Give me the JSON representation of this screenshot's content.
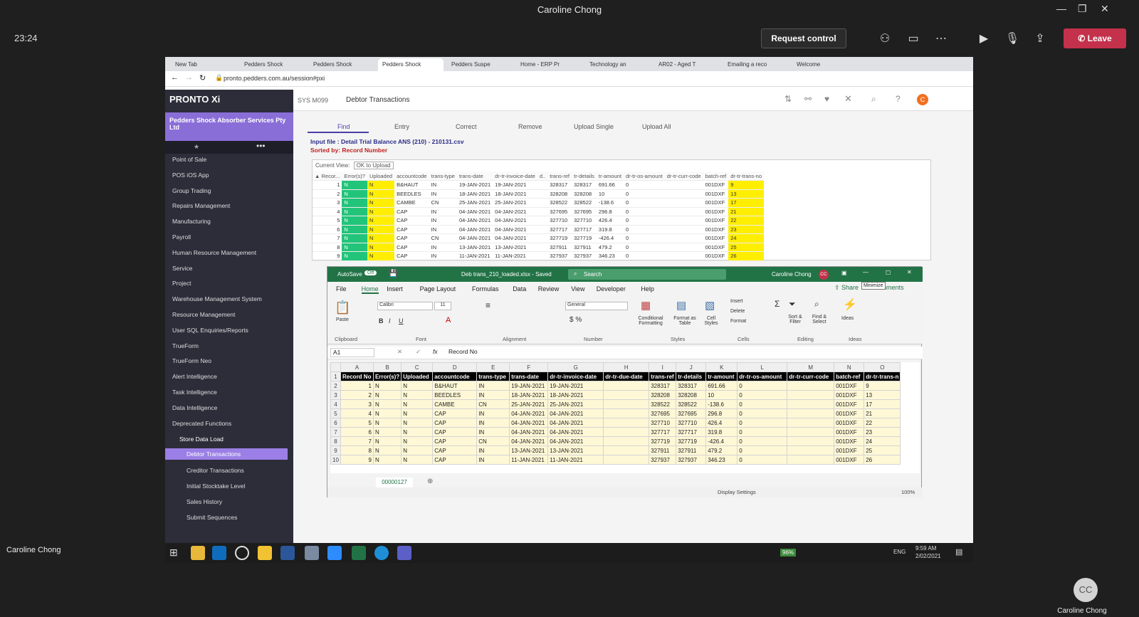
{
  "teams": {
    "title": "Caroline Chong",
    "timer": "23:24",
    "request_control": "Request control",
    "leave": "Leave",
    "participant": "Caroline Chong",
    "avatar_initials": "CC",
    "participant_tile": "Caroline Chong"
  },
  "browser": {
    "tabs": [
      "New Tab",
      "Pedders Shock",
      "Pedders Shock",
      "Pedders Shock",
      "Pedders Suspe",
      "Home - ERP Pr",
      "Technology an",
      "AR02 - Aged T",
      "Emailing a reco",
      "Welcome"
    ],
    "url": "pronto.pedders.com.au/session#pxi"
  },
  "pronto": {
    "logo": "PRONTO Xi",
    "company": "Pedders Shock Absorber Services Pty Ltd",
    "sys": "SYS M099",
    "screen_title": "Debtor Transactions",
    "nav": [
      "Point of Sale",
      "POS iOS App",
      "Group Trading",
      "Repairs Management",
      "Manufacturing",
      "Payroll",
      "Human Resource Management",
      "Service",
      "Project",
      "Warehouse Management System",
      "Resource Management",
      "User SQL Enquiries/Reports",
      "TrueForm",
      "TrueForm Neo",
      "Alert Intelligence",
      "Task Intelligence",
      "Data Intelligence",
      "Deprecated Functions"
    ],
    "store_data_load": "Store Data Load",
    "subnav": [
      "Debtor Transactions",
      "Creditor Transactions",
      "Initial Stocktake Level",
      "Sales History",
      "Submit Sequences"
    ],
    "actions": [
      "Find",
      "Entry",
      "Correct",
      "Remove",
      "Upload Single",
      "Upload All"
    ],
    "input_file": "Input file : Detail Trial Balance ANS (210) - 210131.csv",
    "sorted_by": "Sorted by: Record Number",
    "current_view_label": "Current View:",
    "current_view": "OK to Upload",
    "columns": [
      "▲ Recor...",
      "Error(s)?",
      "Uploaded",
      "accountcode",
      "trans-type",
      "trans-date",
      "dr-tr-invoice-date",
      "d..",
      "trans-ref",
      "tr-details",
      "tr-amount",
      "dr-tr-os-amount",
      "dr-tr-curr-code",
      "batch-ref",
      "dr-tr-trans-no"
    ],
    "rows": [
      [
        "1",
        "N",
        "N",
        "B&HAUT",
        "IN",
        "19-JAN-2021",
        "19-JAN-2021",
        "",
        "328317",
        "328317",
        "691.66",
        "0",
        "",
        "001DXF",
        "9"
      ],
      [
        "2",
        "N",
        "N",
        "BEEDLES",
        "IN",
        "18-JAN-2021",
        "18-JAN-2021",
        "",
        "328208",
        "328208",
        "10",
        "0",
        "",
        "001DXF",
        "13"
      ],
      [
        "3",
        "N",
        "N",
        "CAMBE",
        "CN",
        "25-JAN-2021",
        "25-JAN-2021",
        "",
        "328522",
        "328522",
        "-138.6",
        "0",
        "",
        "001DXF",
        "17"
      ],
      [
        "4",
        "N",
        "N",
        "CAP",
        "IN",
        "04-JAN-2021",
        "04-JAN-2021",
        "",
        "327695",
        "327695",
        "296.8",
        "0",
        "",
        "001DXF",
        "21"
      ],
      [
        "5",
        "N",
        "N",
        "CAP",
        "IN",
        "04-JAN-2021",
        "04-JAN-2021",
        "",
        "327710",
        "327710",
        "426.4",
        "0",
        "",
        "001DXF",
        "22"
      ],
      [
        "6",
        "N",
        "N",
        "CAP",
        "IN",
        "04-JAN-2021",
        "04-JAN-2021",
        "",
        "327717",
        "327717",
        "319.8",
        "0",
        "",
        "001DXF",
        "23"
      ],
      [
        "7",
        "N",
        "N",
        "CAP",
        "CN",
        "04-JAN-2021",
        "04-JAN-2021",
        "",
        "327719",
        "327719",
        "-426.4",
        "0",
        "",
        "001DXF",
        "24"
      ],
      [
        "8",
        "N",
        "N",
        "CAP",
        "IN",
        "13-JAN-2021",
        "13-JAN-2021",
        "",
        "327911",
        "327911",
        "479.2",
        "0",
        "",
        "001DXF",
        "25"
      ],
      [
        "9",
        "N",
        "N",
        "CAP",
        "IN",
        "11-JAN-2021",
        "11-JAN-2021",
        "",
        "327937",
        "327937",
        "346.23",
        "0",
        "",
        "001DXF",
        "26"
      ]
    ]
  },
  "excel": {
    "autosave": "AutoSave",
    "autosave_state": "Off",
    "filename": "Deb trans_210_loaded.xlsx - Saved",
    "search": "Search",
    "user": "Caroline Chong",
    "user_initials": "CC",
    "tooltip": "Minimize",
    "menu": [
      "File",
      "Home",
      "Insert",
      "Page Layout",
      "Formulas",
      "Data",
      "Review",
      "View",
      "Developer",
      "Help"
    ],
    "share": "Share",
    "comments": "Comments",
    "font": "Calibri",
    "font_size": "11",
    "number_format": "General",
    "groups": [
      "Clipboard",
      "Font",
      "Alignment",
      "Number",
      "Styles",
      "Cells",
      "Editing",
      "Ideas"
    ],
    "ribbon_buttons": [
      "Paste",
      "Conditional Formatting",
      "Format as Table",
      "Cell Styles",
      "Insert",
      "Delete",
      "Format",
      "Sort & Filter",
      "Find & Select",
      "Ideas"
    ],
    "namebox": "A1",
    "formula": "Record No",
    "col_letters": [
      "A",
      "B",
      "C",
      "D",
      "E",
      "F",
      "G",
      "H",
      "I",
      "J",
      "K",
      "L",
      "M",
      "N",
      "O"
    ],
    "header": [
      "Record No",
      "Error(s)?",
      "Uploaded",
      "accountcode",
      "trans-type",
      "trans-date",
      "dr-tr-invoice-date",
      "dr-tr-due-date",
      "trans-ref",
      "tr-details",
      "tr-amount",
      "dr-tr-os-amount",
      "dr-tr-curr-code",
      "batch-ref",
      "dr-tr-trans-n"
    ],
    "rows": [
      [
        "2",
        "1",
        "N",
        "N",
        "B&HAUT",
        "IN",
        "19-JAN-2021",
        "19-JAN-2021",
        "",
        "328317",
        "328317",
        "691.66",
        "0",
        "",
        "001DXF",
        "9"
      ],
      [
        "3",
        "2",
        "N",
        "N",
        "BEEDLES",
        "IN",
        "18-JAN-2021",
        "18-JAN-2021",
        "",
        "328208",
        "328208",
        "10",
        "0",
        "",
        "001DXF",
        "13"
      ],
      [
        "4",
        "3",
        "N",
        "N",
        "CAMBE",
        "CN",
        "25-JAN-2021",
        "25-JAN-2021",
        "",
        "328522",
        "328522",
        "-138.6",
        "0",
        "",
        "001DXF",
        "17"
      ],
      [
        "5",
        "4",
        "N",
        "N",
        "CAP",
        "IN",
        "04-JAN-2021",
        "04-JAN-2021",
        "",
        "327695",
        "327695",
        "296.8",
        "0",
        "",
        "001DXF",
        "21"
      ],
      [
        "6",
        "5",
        "N",
        "N",
        "CAP",
        "IN",
        "04-JAN-2021",
        "04-JAN-2021",
        "",
        "327710",
        "327710",
        "426.4",
        "0",
        "",
        "001DXF",
        "22"
      ],
      [
        "7",
        "6",
        "N",
        "N",
        "CAP",
        "IN",
        "04-JAN-2021",
        "04-JAN-2021",
        "",
        "327717",
        "327717",
        "319.8",
        "0",
        "",
        "001DXF",
        "23"
      ],
      [
        "8",
        "7",
        "N",
        "N",
        "CAP",
        "CN",
        "04-JAN-2021",
        "04-JAN-2021",
        "",
        "327719",
        "327719",
        "-426.4",
        "0",
        "",
        "001DXF",
        "24"
      ],
      [
        "9",
        "8",
        "N",
        "N",
        "CAP",
        "IN",
        "13-JAN-2021",
        "13-JAN-2021",
        "",
        "327911",
        "327911",
        "479.2",
        "0",
        "",
        "001DXF",
        "25"
      ],
      [
        "10",
        "9",
        "N",
        "N",
        "CAP",
        "IN",
        "11-JAN-2021",
        "11-JAN-2021",
        "",
        "327937",
        "327937",
        "346.23",
        "0",
        "",
        "001DXF",
        "26"
      ]
    ],
    "sheet": "00000127",
    "display_settings": "Display Settings",
    "zoom": "100%"
  },
  "taskbar": {
    "battery": "96%",
    "lang": "ENG",
    "time": "9:59 AM",
    "date": "2/02/2021"
  },
  "colors": {
    "teams_bg": "#1f1f1f",
    "leave": "#c4314b",
    "excel_green": "#217346",
    "pronto_purple": "#8a6ed8",
    "upload_green": "#22c47a",
    "upload_yellow": "#ffee00"
  }
}
